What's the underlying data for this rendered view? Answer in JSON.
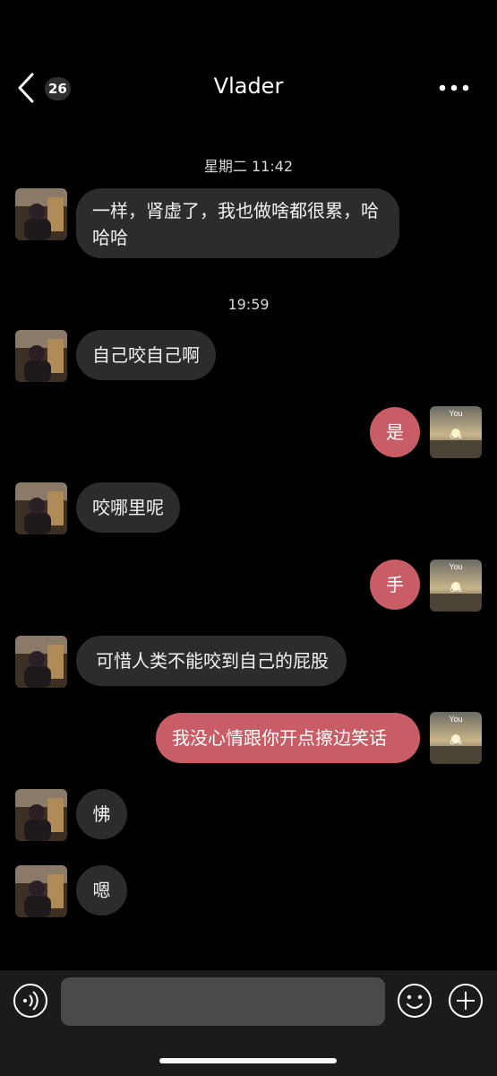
{
  "header": {
    "back_badge": "26",
    "title": "Vlader"
  },
  "messages": {
    "time_1": "星期二 11:42",
    "m1": "一样，肾虚了，我也做啥都很累，哈哈哈",
    "time_2": "19:59",
    "m2": "自己咬自己啊",
    "m3": "是",
    "m4": "咬哪里呢",
    "m5": "手",
    "m6": "可惜人类不能咬到自己的屁股",
    "m7": "我没心情跟你开点擦边笑话",
    "m8": "怫",
    "m9": "嗯"
  },
  "self_avatar": {
    "top_text": "You",
    "mid_text": "Of a"
  },
  "icons": {
    "back": "chevron-left-icon",
    "more": "more-horizontal-icon",
    "voice": "voice-icon",
    "emoji": "emoji-icon",
    "plus": "plus-icon"
  },
  "colors": {
    "background": "#000000",
    "incoming_bubble": "#2c2c2e",
    "outgoing_bubble": "#c85d66",
    "input_bar": "#1b1b1d"
  }
}
